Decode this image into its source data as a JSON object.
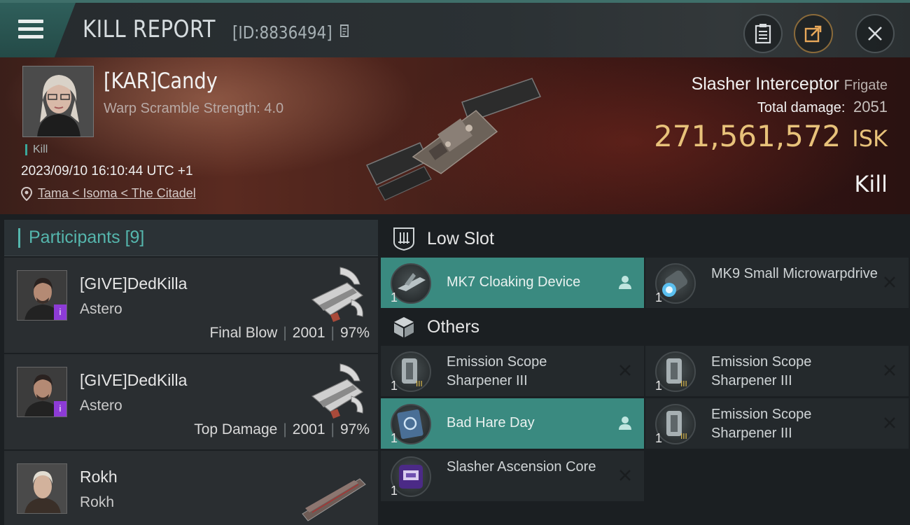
{
  "header": {
    "title": "KILL REPORT",
    "report_id": "[ID:8836494]"
  },
  "victim": {
    "name": "[KAR]Candy",
    "warp_scramble": "Warp Scramble Strength: 4.0",
    "tag": "Kill",
    "datetime": "2023/09/10 16:10:44 UTC +1",
    "location": "Tama < Isoma < The Citadel",
    "ship_name": "Slasher Interceptor",
    "ship_class": "Frigate",
    "total_damage_label": "Total damage:",
    "total_damage": "2051",
    "isk_value": "271,561,572",
    "isk_unit": "ISK",
    "result": "Kill"
  },
  "participants": {
    "label": "Participants",
    "count": "[9]",
    "rows": [
      {
        "name": "[GIVE]DedKilla",
        "ship": "Astero",
        "role": "Final Blow",
        "damage": "2001",
        "percent": "97%",
        "badge": "i"
      },
      {
        "name": "[GIVE]DedKilla",
        "ship": "Astero",
        "role": "Top Damage",
        "damage": "2001",
        "percent": "97%",
        "badge": "i"
      },
      {
        "name": "Rokh",
        "ship": "Rokh",
        "role": "",
        "damage": "",
        "percent": "",
        "badge": ""
      }
    ]
  },
  "fitting": {
    "low_slot_label": "Low Slot",
    "others_label": "Others",
    "low_slot": [
      {
        "name": "MK7 Cloaking Device",
        "qty": "1",
        "highlight": true,
        "action": "person-icon"
      },
      {
        "name": "MK9 Small Microwarpdrive",
        "qty": "1",
        "highlight": false,
        "action": "close-icon"
      }
    ],
    "others": [
      {
        "name": "Emission Scope Sharpener III",
        "qty": "1",
        "highlight": false,
        "action": "close-icon"
      },
      {
        "name": "Emission Scope Sharpener III",
        "qty": "1",
        "highlight": false,
        "action": "close-icon"
      },
      {
        "name": "Bad Hare Day",
        "qty": "1",
        "highlight": true,
        "action": "person-icon"
      },
      {
        "name": "Emission Scope Sharpener III",
        "qty": "1",
        "highlight": false,
        "action": "close-icon"
      },
      {
        "name": "Slasher Ascension Core",
        "qty": "1",
        "highlight": false,
        "action": "close-icon"
      }
    ]
  },
  "colors": {
    "accent": "#55b6ad",
    "highlight_row": "#3a8a80",
    "isk": "#e8c27a",
    "badge": "#8d3bd6"
  }
}
